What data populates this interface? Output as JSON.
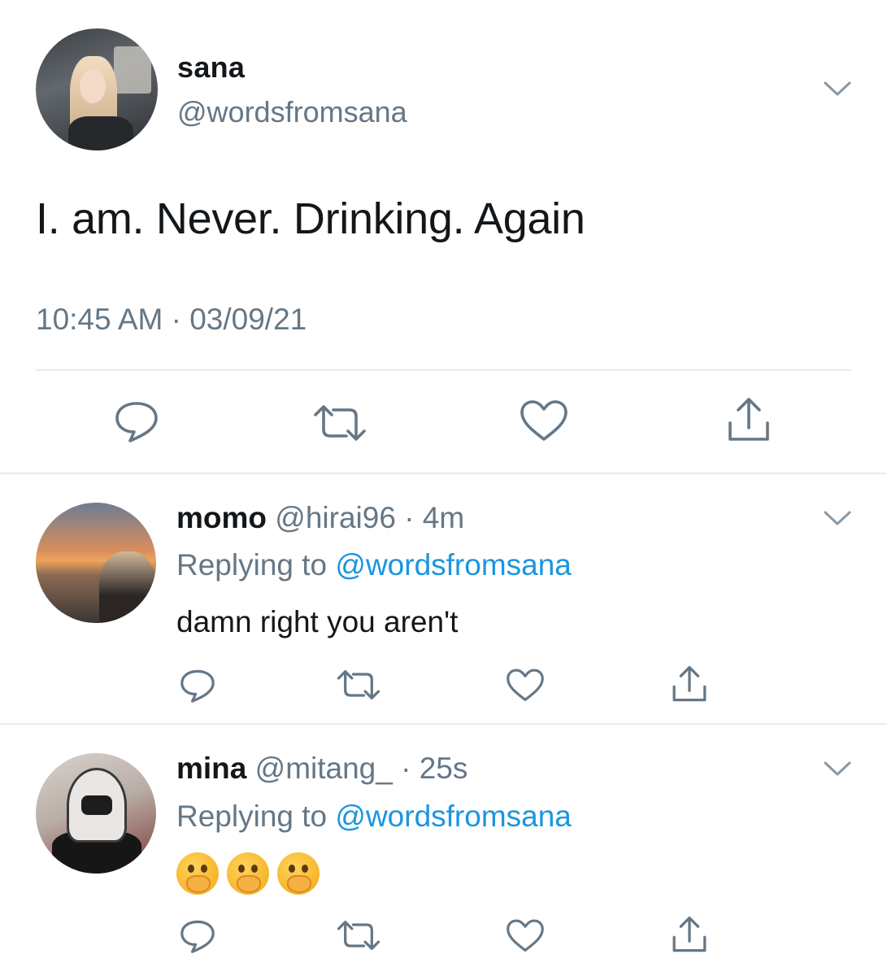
{
  "main_tweet": {
    "display_name": "sana",
    "handle": "@wordsfromsana",
    "text": "I. am. Never. Drinking. Again",
    "timestamp": "10:45 AM · 03/09/21",
    "actions": [
      "reply-icon",
      "retweet-icon",
      "like-icon",
      "share-icon"
    ]
  },
  "replies": [
    {
      "display_name": "momo",
      "meta": "@hirai96 · 4m",
      "replying_prefix": "Replying to ",
      "replying_to": "@wordsfromsana",
      "text": "damn right you aren't"
    },
    {
      "display_name": "mina",
      "meta": "@mitang_ · 25s",
      "replying_prefix": "Replying to ",
      "replying_to": "@wordsfromsana",
      "emojis": [
        "face-with-hand-over-mouth-emoji",
        "face-with-hand-over-mouth-emoji",
        "face-with-hand-over-mouth-emoji"
      ]
    }
  ],
  "colors": {
    "text_primary": "#14171a",
    "text_secondary": "#657786",
    "link": "#1b95e0",
    "divider": "#e6ecf0",
    "icon": "#657786"
  }
}
